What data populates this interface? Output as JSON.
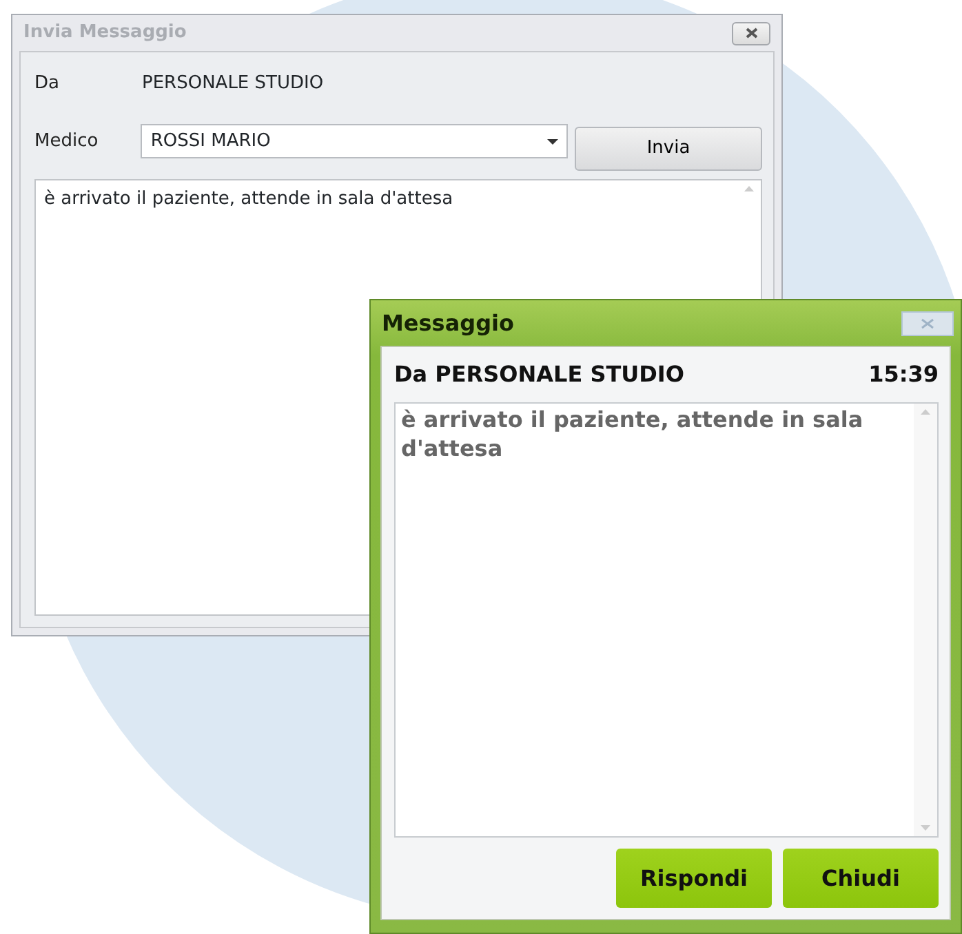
{
  "send_window": {
    "title": "Invia Messaggio",
    "from_label": "Da",
    "from_value": "PERSONALE STUDIO",
    "doctor_label": "Medico",
    "doctor_value": "ROSSI MARIO",
    "send_button": "Invia",
    "message": "è arrivato il paziente, attende in sala d'attesa"
  },
  "message_window": {
    "title": "Messaggio",
    "sender": "Da PERSONALE STUDIO",
    "time": "15:39",
    "message": "è arrivato il paziente, attende in sala d'attesa",
    "buttons": [
      "Rispondi",
      "Chiudi"
    ]
  }
}
